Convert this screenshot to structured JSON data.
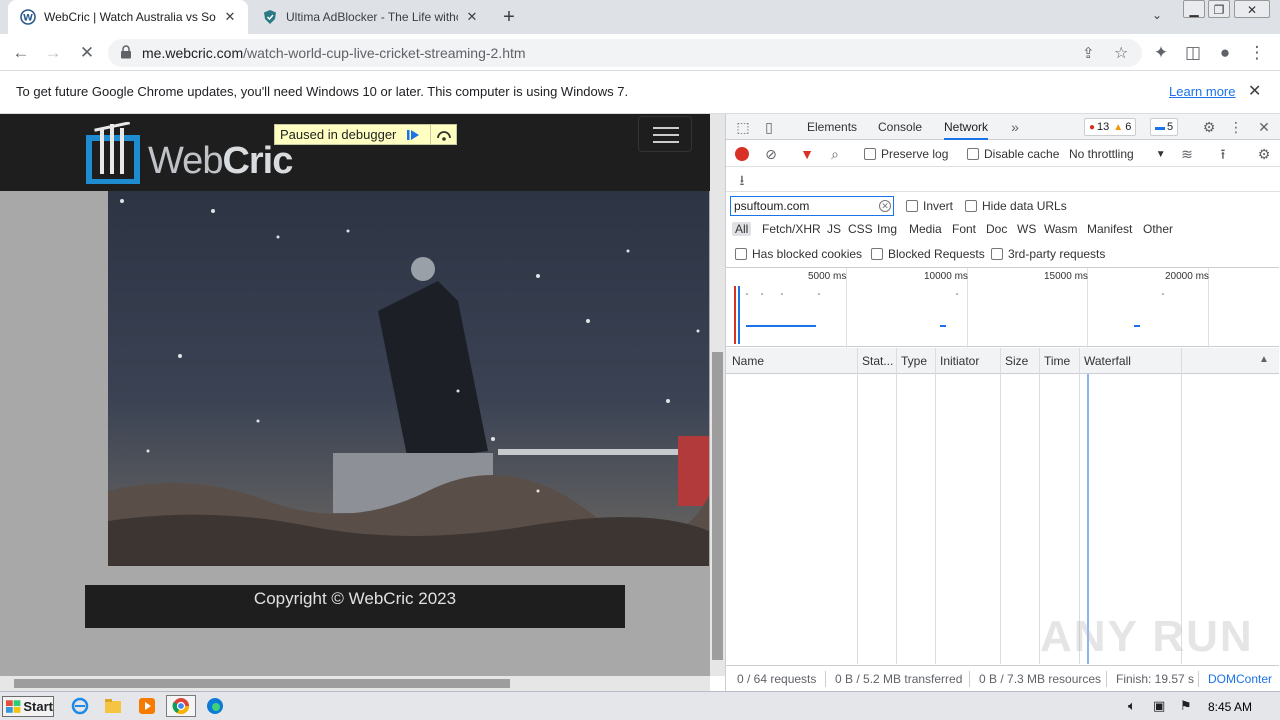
{
  "tabs": [
    {
      "title": "WebCric | Watch Australia vs South",
      "active": true
    },
    {
      "title": "Ultima AdBlocker - The Life without A",
      "active": false
    }
  ],
  "address": {
    "domain": "me.webcric.com",
    "path": "/watch-world-cup-live-cricket-streaming-2.htm"
  },
  "infobar": {
    "message": "To get future Google Chrome updates, you'll need Windows 10 or later. This computer is using Windows 7.",
    "link": "Learn more"
  },
  "page": {
    "logo_prefix": "Web",
    "logo_bold": "Cric",
    "debugger_badge": "Paused in debugger",
    "footer": "Copyright © WebCric 2023"
  },
  "devtools": {
    "tabs": [
      "Elements",
      "Console",
      "Network"
    ],
    "active_tab": "Network",
    "counters": {
      "errors": "13",
      "warnings": "6",
      "messages": "5"
    },
    "toolbar": {
      "preserve_log": "Preserve log",
      "disable_cache": "Disable cache",
      "throttling": "No throttling"
    },
    "filter": {
      "value": "psuftoum.com",
      "invert": "Invert",
      "hide_data_urls": "Hide data URLs"
    },
    "types": [
      "All",
      "Fetch/XHR",
      "JS",
      "CSS",
      "Img",
      "Media",
      "Font",
      "Doc",
      "WS",
      "Wasm",
      "Manifest",
      "Other"
    ],
    "options": {
      "blocked_cookies": "Has blocked cookies",
      "blocked_requests": "Blocked Requests",
      "third_party": "3rd-party requests"
    },
    "overview_ticks": [
      "5000 ms",
      "10000 ms",
      "15000 ms",
      "20000 ms"
    ],
    "columns": [
      "Name",
      "Stat...",
      "Type",
      "Initiator",
      "Size",
      "Time",
      "Waterfall"
    ],
    "status": {
      "requests": "0 / 64 requests",
      "transferred": "0 B / 5.2 MB transferred",
      "resources": "0 B / 7.3 MB resources",
      "finish": "Finish: 19.57 s",
      "domcontent": "DOMConter"
    }
  },
  "taskbar": {
    "start": "Start",
    "clock": "8:45 AM"
  },
  "watermark": "ANY RUN",
  "colors": {
    "accent": "#1a73e8",
    "record": "#d93025",
    "devtools_bg": "#f1f3f4"
  }
}
